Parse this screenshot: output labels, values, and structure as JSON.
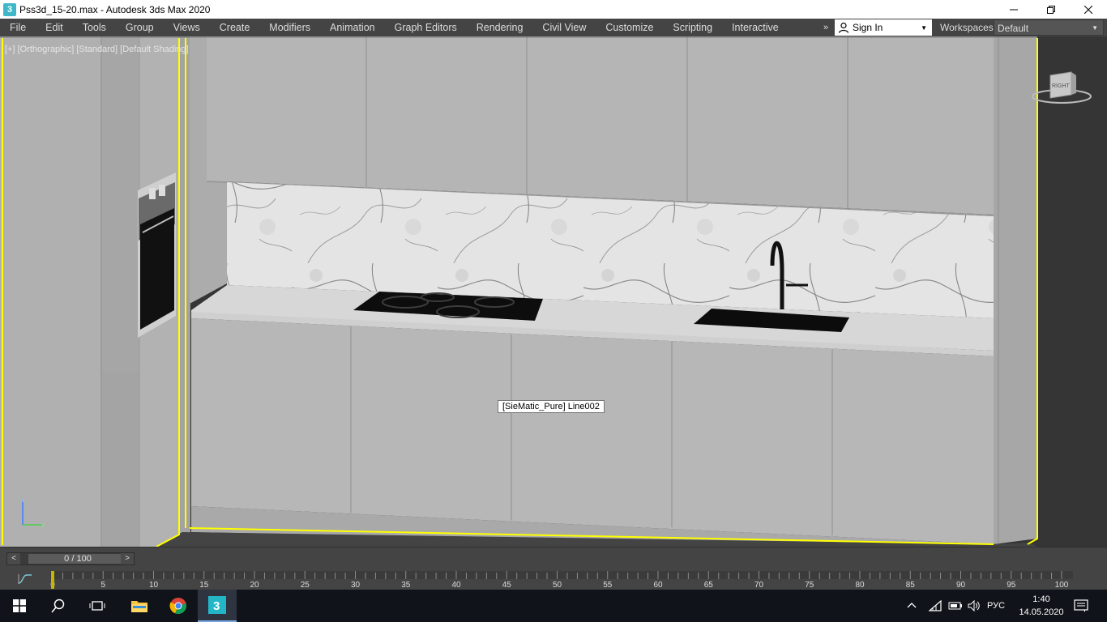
{
  "window": {
    "app_icon": "3",
    "title": "Pss3d_15-20.max - Autodesk 3ds Max 2020",
    "controls": [
      "minimize-icon",
      "restore-icon",
      "close-icon"
    ]
  },
  "menu": {
    "items": [
      "File",
      "Edit",
      "Tools",
      "Group",
      "Views",
      "Create",
      "Modifiers",
      "Animation",
      "Graph Editors",
      "Rendering",
      "Civil View",
      "Customize",
      "Scripting",
      "Interactive"
    ],
    "overflow": "»",
    "sign_in": "Sign In",
    "workspaces_label": "Workspaces:",
    "workspace_value": "Default"
  },
  "viewport": {
    "label": "[+] [Orthographic] [Standard] [Default Shading]",
    "tooltip": "[SieMatic_Pure] Line002",
    "viewcube_face": "RIGHT",
    "axis_x": "y",
    "axis_z": "z",
    "highlight_color": "#ffff00"
  },
  "timeline": {
    "frame_display": "0 / 100",
    "prev": "<",
    "next": ">",
    "current_frame": 0,
    "ticks": [
      "0",
      "5",
      "10",
      "15",
      "20",
      "25",
      "30",
      "35",
      "40",
      "45",
      "50",
      "55",
      "60",
      "65",
      "70",
      "75",
      "80",
      "85",
      "90",
      "95",
      "100"
    ]
  },
  "taskbar": {
    "icons": [
      "windows-start-icon",
      "search-icon",
      "task-view-icon",
      "file-explorer-icon",
      "chrome-icon",
      "3dsmax-icon"
    ],
    "tray": {
      "language": "РУС",
      "time": "1:40",
      "date": "14.05.2020"
    }
  }
}
